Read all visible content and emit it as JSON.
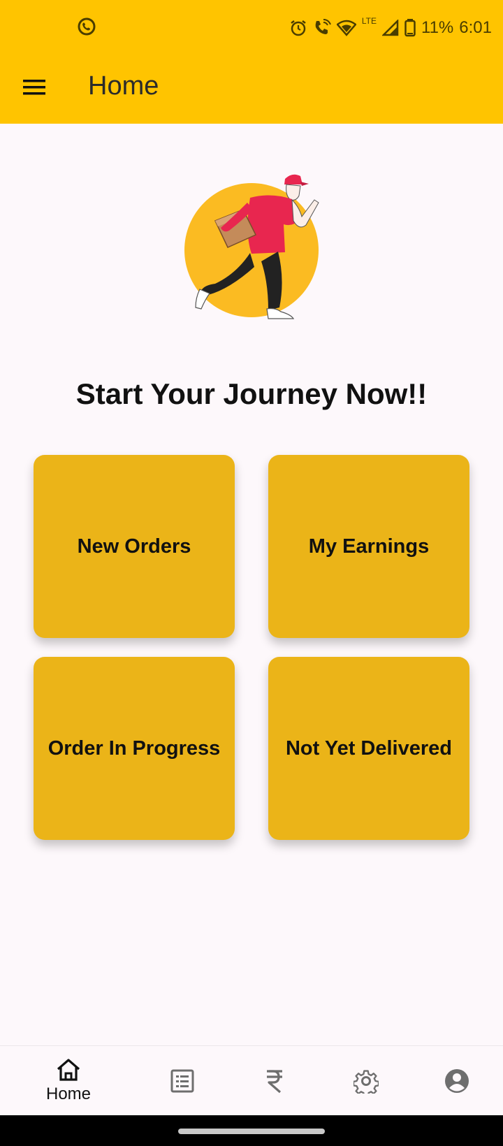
{
  "status_bar": {
    "battery_percent": "11%",
    "time": "6:01",
    "network_label": "LTE"
  },
  "app_bar": {
    "title": "Home"
  },
  "main": {
    "headline": "Start Your Journey Now!!",
    "tiles": [
      {
        "label": "New Orders"
      },
      {
        "label": "My Earnings"
      },
      {
        "label": "Order In Progress"
      },
      {
        "label": "Not Yet Delivered"
      }
    ]
  },
  "bottom_nav": {
    "items": [
      {
        "icon": "home-icon",
        "label": "Home",
        "active": true
      },
      {
        "icon": "list-icon",
        "label": ""
      },
      {
        "icon": "rupee-icon",
        "label": ""
      },
      {
        "icon": "settings-icon",
        "label": ""
      },
      {
        "icon": "account-icon",
        "label": ""
      }
    ]
  },
  "colors": {
    "app_bar": "#ffc400",
    "tile": "#ebb418",
    "background": "#fdf8fb",
    "inactive_icon": "#6e6e6e"
  }
}
